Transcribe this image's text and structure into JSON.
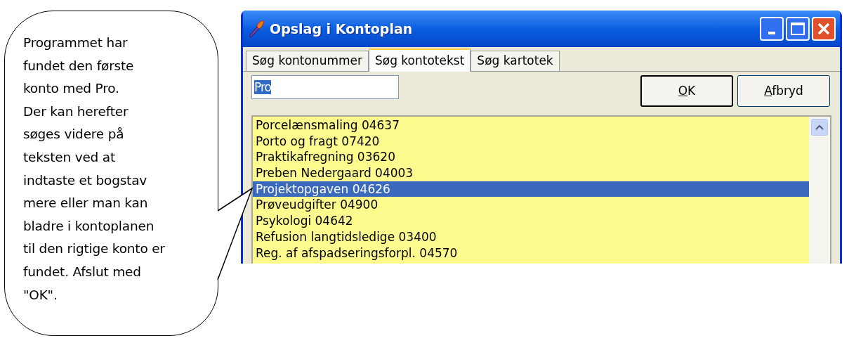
{
  "callout": {
    "text": "Programmet har\nfundet den første\nkonto med Pro.\nDer kan herefter\nsøges videre på\nteksten ved at\nindtaste et bogstav\nmere eller man kan\nbladre i kontoplanen\ntil den rigtige konto er\nfundet. Afslut med\n\"OK\"."
  },
  "window": {
    "title": "Opslag i Kontoplan"
  },
  "tabs": [
    {
      "label": "Søg kontonummer",
      "selected": false
    },
    {
      "label": "Søg kontotekst",
      "selected": true
    },
    {
      "label": "Søg kartotek",
      "selected": false
    }
  ],
  "search": {
    "value": "Pro"
  },
  "buttons": [
    {
      "label": "OK",
      "default": true
    },
    {
      "label": "Afbryd",
      "default": false
    }
  ],
  "list": [
    {
      "text": "Porcelænsmaling 04637",
      "selected": false
    },
    {
      "text": "Porto og fragt 07420",
      "selected": false
    },
    {
      "text": "Praktikafregning 03620",
      "selected": false
    },
    {
      "text": "Preben Nedergaard 04003",
      "selected": false
    },
    {
      "text": "Projektopgaven 04626",
      "selected": true
    },
    {
      "text": "Prøveudgifter 04900",
      "selected": false
    },
    {
      "text": "Psykologi 04642",
      "selected": false
    },
    {
      "text": "Refusion langtidsledige 03400",
      "selected": false
    },
    {
      "text": "Reg. af afspadseringsforpl. 04570",
      "selected": false
    }
  ]
}
